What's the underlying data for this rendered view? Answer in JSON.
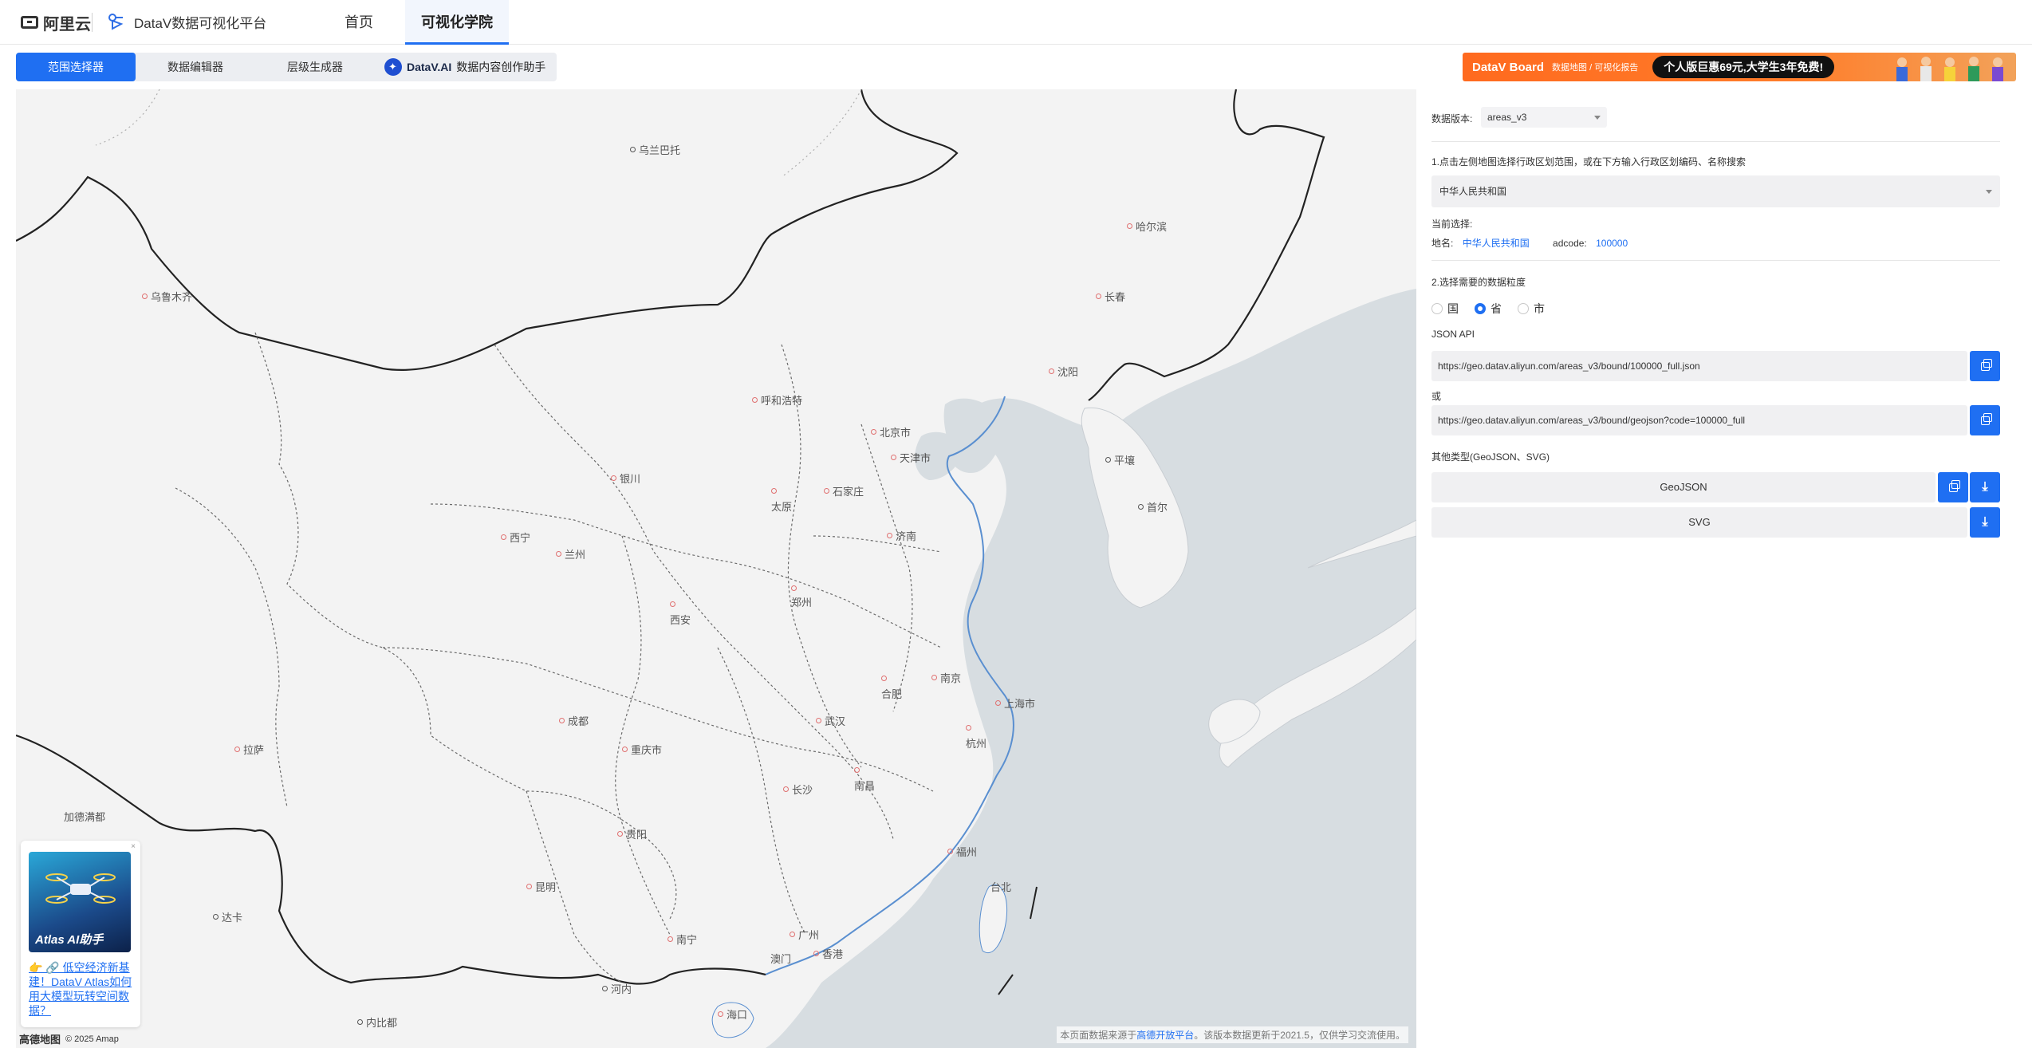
{
  "header": {
    "logo_text": "阿里云",
    "brand_text": "DataV数据可视化平台",
    "nav": [
      "首页",
      "可视化学院"
    ]
  },
  "tabs": {
    "items": [
      "范围选择器",
      "数据编辑器",
      "层级生成器"
    ],
    "ai_name": "DataV.AI",
    "ai_desc": "数据内容创作助手"
  },
  "banner": {
    "title": "DataV Board",
    "sub": "数据地图 / 可视化报告",
    "promo": "个人版巨惠69元,大学生3年免费!"
  },
  "map": {
    "cities": [
      {
        "name": "乌兰巴托",
        "dark": true
      },
      {
        "name": "乌鲁木齐",
        "dark": false
      },
      {
        "name": "哈尔滨",
        "dark": false
      },
      {
        "name": "长春",
        "dark": false
      },
      {
        "name": "沈阳",
        "dark": false
      },
      {
        "name": "呼和浩特",
        "dark": false
      },
      {
        "name": "北京市",
        "dark": false
      },
      {
        "name": "天津市",
        "dark": false
      },
      {
        "name": "平壤",
        "dark": true
      },
      {
        "name": "首尔",
        "dark": true
      },
      {
        "name": "银川",
        "dark": false
      },
      {
        "name": "石家庄",
        "dark": false
      },
      {
        "name": "太原",
        "dark": false
      },
      {
        "name": "济南",
        "dark": false
      },
      {
        "name": "西宁",
        "dark": false
      },
      {
        "name": "兰州",
        "dark": false
      },
      {
        "name": "郑州",
        "dark": false
      },
      {
        "name": "西安",
        "dark": false
      },
      {
        "name": "南京",
        "dark": false
      },
      {
        "name": "合肥",
        "dark": false
      },
      {
        "name": "上海市",
        "dark": false
      },
      {
        "name": "成都",
        "dark": false
      },
      {
        "name": "武汉",
        "dark": false
      },
      {
        "name": "杭州",
        "dark": false
      },
      {
        "name": "拉萨",
        "dark": false
      },
      {
        "name": "重庆市",
        "dark": false
      },
      {
        "name": "南昌",
        "dark": false
      },
      {
        "name": "长沙",
        "dark": false
      },
      {
        "name": "加德满都",
        "dark": true
      },
      {
        "name": "贵阳",
        "dark": false
      },
      {
        "name": "福州",
        "dark": false
      },
      {
        "name": "昆明",
        "dark": false
      },
      {
        "name": "台北",
        "dark": false
      },
      {
        "name": "达卡",
        "dark": true
      },
      {
        "name": "南宁",
        "dark": false
      },
      {
        "name": "广州",
        "dark": false
      },
      {
        "name": "澳门",
        "dark": false
      },
      {
        "name": "香港",
        "dark": false
      },
      {
        "name": "河内",
        "dark": true
      },
      {
        "name": "海口",
        "dark": false
      },
      {
        "name": "内比都",
        "dark": true
      }
    ],
    "attribution_prefix": "本页面数据来源于",
    "attribution_link": "高德开放平台",
    "attribution_suffix": "。该版本数据更新于2021.5，仅供学习交流使用。",
    "amap_logo": "高德地图",
    "amap_copyright": "© 2025 Amap"
  },
  "ad": {
    "label": "Atlas AI助手",
    "close": "×",
    "text": "👉 🔗 低空经济新基建！DataV Atlas如何用大模型玩转空间数据？"
  },
  "panel": {
    "version_label": "数据版本:",
    "version_value": "areas_v3",
    "step1": "1.点击左侧地图选择行政区划范围，或在下方输入行政区划编码、名称搜索",
    "region_value": "中华人民共和国",
    "current_label": "当前选择:",
    "place_label": "地名:",
    "place_value": "中华人民共和国",
    "adcode_label": "adcode:",
    "adcode_value": "100000",
    "step2": "2.选择需要的数据粒度",
    "granularity": [
      "国",
      "省",
      "市"
    ],
    "granularity_selected": "省",
    "json_api_label": "JSON API",
    "json_api_url": "https://geo.datav.aliyun.com/areas_v3/bound/100000_full.json",
    "or_label": "或",
    "geojson_url": "https://geo.datav.aliyun.com/areas_v3/bound/geojson?code=100000_full",
    "other_label": "其他类型(GeoJSON、SVG)",
    "geojson_btn": "GeoJSON",
    "svg_btn": "SVG"
  }
}
